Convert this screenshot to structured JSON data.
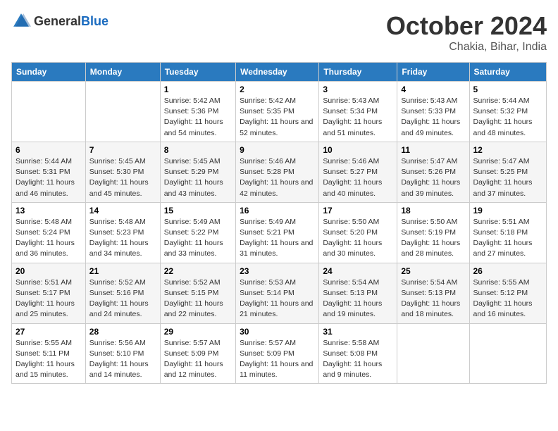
{
  "header": {
    "logo_general": "General",
    "logo_blue": "Blue",
    "title": "October 2024",
    "location": "Chakia, Bihar, India"
  },
  "weekdays": [
    "Sunday",
    "Monday",
    "Tuesday",
    "Wednesday",
    "Thursday",
    "Friday",
    "Saturday"
  ],
  "weeks": [
    [
      {
        "day": "",
        "info": ""
      },
      {
        "day": "",
        "info": ""
      },
      {
        "day": "1",
        "info": "Sunrise: 5:42 AM\nSunset: 5:36 PM\nDaylight: 11 hours and 54 minutes."
      },
      {
        "day": "2",
        "info": "Sunrise: 5:42 AM\nSunset: 5:35 PM\nDaylight: 11 hours and 52 minutes."
      },
      {
        "day": "3",
        "info": "Sunrise: 5:43 AM\nSunset: 5:34 PM\nDaylight: 11 hours and 51 minutes."
      },
      {
        "day": "4",
        "info": "Sunrise: 5:43 AM\nSunset: 5:33 PM\nDaylight: 11 hours and 49 minutes."
      },
      {
        "day": "5",
        "info": "Sunrise: 5:44 AM\nSunset: 5:32 PM\nDaylight: 11 hours and 48 minutes."
      }
    ],
    [
      {
        "day": "6",
        "info": "Sunrise: 5:44 AM\nSunset: 5:31 PM\nDaylight: 11 hours and 46 minutes."
      },
      {
        "day": "7",
        "info": "Sunrise: 5:45 AM\nSunset: 5:30 PM\nDaylight: 11 hours and 45 minutes."
      },
      {
        "day": "8",
        "info": "Sunrise: 5:45 AM\nSunset: 5:29 PM\nDaylight: 11 hours and 43 minutes."
      },
      {
        "day": "9",
        "info": "Sunrise: 5:46 AM\nSunset: 5:28 PM\nDaylight: 11 hours and 42 minutes."
      },
      {
        "day": "10",
        "info": "Sunrise: 5:46 AM\nSunset: 5:27 PM\nDaylight: 11 hours and 40 minutes."
      },
      {
        "day": "11",
        "info": "Sunrise: 5:47 AM\nSunset: 5:26 PM\nDaylight: 11 hours and 39 minutes."
      },
      {
        "day": "12",
        "info": "Sunrise: 5:47 AM\nSunset: 5:25 PM\nDaylight: 11 hours and 37 minutes."
      }
    ],
    [
      {
        "day": "13",
        "info": "Sunrise: 5:48 AM\nSunset: 5:24 PM\nDaylight: 11 hours and 36 minutes."
      },
      {
        "day": "14",
        "info": "Sunrise: 5:48 AM\nSunset: 5:23 PM\nDaylight: 11 hours and 34 minutes."
      },
      {
        "day": "15",
        "info": "Sunrise: 5:49 AM\nSunset: 5:22 PM\nDaylight: 11 hours and 33 minutes."
      },
      {
        "day": "16",
        "info": "Sunrise: 5:49 AM\nSunset: 5:21 PM\nDaylight: 11 hours and 31 minutes."
      },
      {
        "day": "17",
        "info": "Sunrise: 5:50 AM\nSunset: 5:20 PM\nDaylight: 11 hours and 30 minutes."
      },
      {
        "day": "18",
        "info": "Sunrise: 5:50 AM\nSunset: 5:19 PM\nDaylight: 11 hours and 28 minutes."
      },
      {
        "day": "19",
        "info": "Sunrise: 5:51 AM\nSunset: 5:18 PM\nDaylight: 11 hours and 27 minutes."
      }
    ],
    [
      {
        "day": "20",
        "info": "Sunrise: 5:51 AM\nSunset: 5:17 PM\nDaylight: 11 hours and 25 minutes."
      },
      {
        "day": "21",
        "info": "Sunrise: 5:52 AM\nSunset: 5:16 PM\nDaylight: 11 hours and 24 minutes."
      },
      {
        "day": "22",
        "info": "Sunrise: 5:52 AM\nSunset: 5:15 PM\nDaylight: 11 hours and 22 minutes."
      },
      {
        "day": "23",
        "info": "Sunrise: 5:53 AM\nSunset: 5:14 PM\nDaylight: 11 hours and 21 minutes."
      },
      {
        "day": "24",
        "info": "Sunrise: 5:54 AM\nSunset: 5:13 PM\nDaylight: 11 hours and 19 minutes."
      },
      {
        "day": "25",
        "info": "Sunrise: 5:54 AM\nSunset: 5:13 PM\nDaylight: 11 hours and 18 minutes."
      },
      {
        "day": "26",
        "info": "Sunrise: 5:55 AM\nSunset: 5:12 PM\nDaylight: 11 hours and 16 minutes."
      }
    ],
    [
      {
        "day": "27",
        "info": "Sunrise: 5:55 AM\nSunset: 5:11 PM\nDaylight: 11 hours and 15 minutes."
      },
      {
        "day": "28",
        "info": "Sunrise: 5:56 AM\nSunset: 5:10 PM\nDaylight: 11 hours and 14 minutes."
      },
      {
        "day": "29",
        "info": "Sunrise: 5:57 AM\nSunset: 5:09 PM\nDaylight: 11 hours and 12 minutes."
      },
      {
        "day": "30",
        "info": "Sunrise: 5:57 AM\nSunset: 5:09 PM\nDaylight: 11 hours and 11 minutes."
      },
      {
        "day": "31",
        "info": "Sunrise: 5:58 AM\nSunset: 5:08 PM\nDaylight: 11 hours and 9 minutes."
      },
      {
        "day": "",
        "info": ""
      },
      {
        "day": "",
        "info": ""
      }
    ]
  ]
}
